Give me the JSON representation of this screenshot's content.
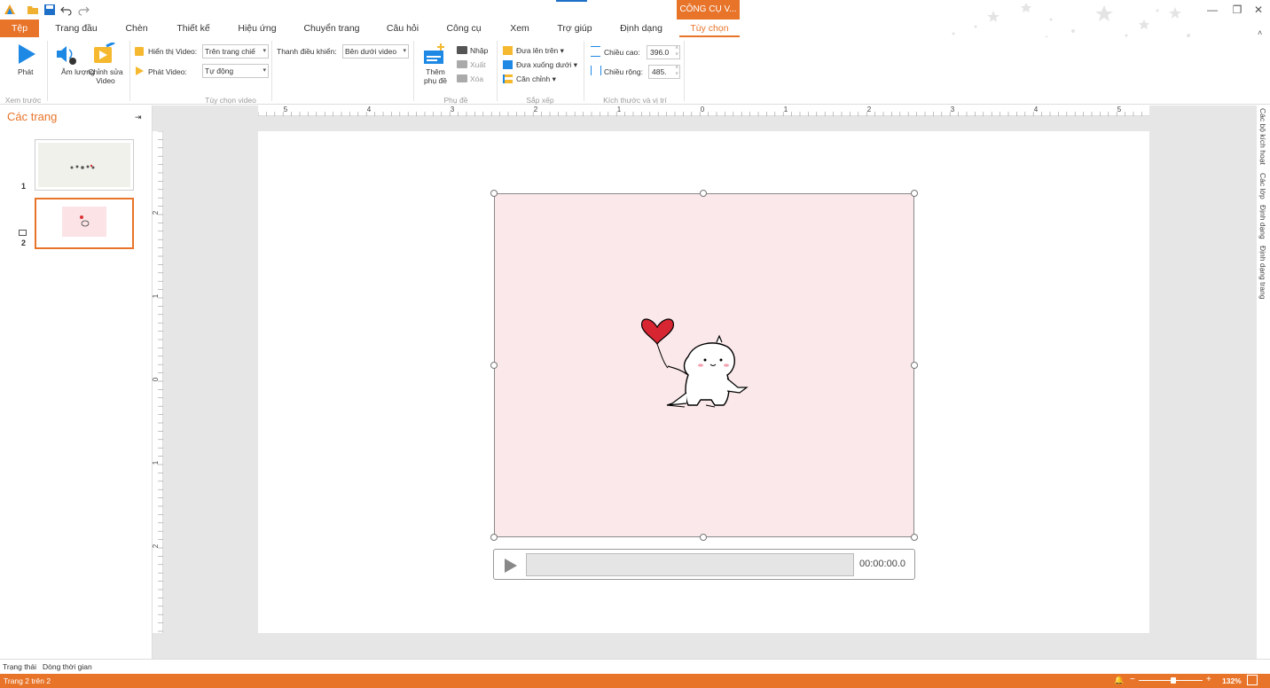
{
  "title_bar": {
    "contextual_tab": "CÔNG CỤ V...",
    "window_controls": [
      "minimize",
      "restore",
      "close"
    ]
  },
  "tabs": [
    "Tệp",
    "Trang đầu",
    "Chèn",
    "Thiết kế",
    "Hiệu ứng",
    "Chuyển trang",
    "Câu hỏi",
    "Công cụ",
    "Xem",
    "Trợ giúp",
    "Định dạng",
    "Tùy chọn"
  ],
  "ribbon": {
    "preview": {
      "play": "Phát",
      "group": "Xem trước"
    },
    "video_options": {
      "volume": "Âm lượng",
      "edit_video": "Chỉnh sửa Video",
      "display_label": "Hiển thị Video:",
      "display_value": "Trên trang chiế",
      "play_label": "Phát Video:",
      "play_value": "Tự động",
      "controls_label": "Thanh điều khiển:",
      "controls_value": "Bên dưới video",
      "group": "Tùy chọn video"
    },
    "subtitles": {
      "add": "Thêm phụ đề",
      "import": "Nhập",
      "export": "Xuất",
      "delete": "Xóa",
      "group": "Phụ đề"
    },
    "arrange": {
      "bring_front": "Đưa lên trên",
      "send_back": "Đưa xuống dưới",
      "align": "Căn chỉnh",
      "group": "Sắp xếp"
    },
    "size": {
      "height_label": "Chiều cao:",
      "height_value": "396.0",
      "width_label": "Chiều rộng:",
      "width_value": "485.",
      "group": "Kích thước và vị trí"
    }
  },
  "left_panel": {
    "title": "Các trang",
    "slides": [
      {
        "number": "1"
      },
      {
        "number": "2"
      }
    ]
  },
  "ruler": {
    "h_labels": [
      "5",
      "4",
      "3",
      "2",
      "1",
      "0",
      "1",
      "2",
      "3",
      "4",
      "5"
    ],
    "v_labels": [
      "2",
      "1",
      "0",
      "1",
      "2"
    ]
  },
  "player": {
    "time": "00:00:00.0"
  },
  "right_sidebar": [
    "Các bộ kích hoạt",
    "Các lớp",
    "Định dạng",
    "Định dạng trang"
  ],
  "bottom_tabs": [
    "Trạng thái",
    "Dòng thời gian"
  ],
  "status": {
    "page": "Trang 2 trên 2",
    "zoom": "132%"
  },
  "colors": {
    "accent": "#e8742a",
    "video_bg": "#fbe8ea"
  }
}
